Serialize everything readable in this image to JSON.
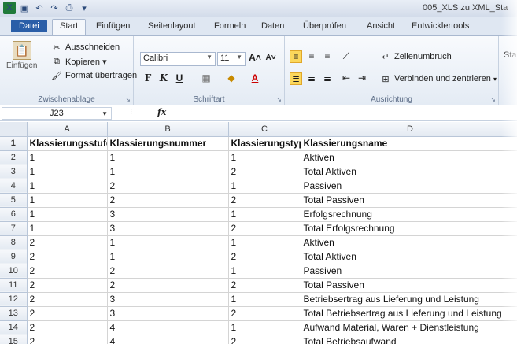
{
  "window": {
    "title": "005_XLS zu XML_Sta"
  },
  "tabs": [
    "Datei",
    "Start",
    "Einfügen",
    "Seitenlayout",
    "Formeln",
    "Daten",
    "Überprüfen",
    "Ansicht",
    "Entwicklertools"
  ],
  "ribbon": {
    "clipboard": {
      "paste": "Einfügen",
      "cut": "Ausschneiden",
      "copy": "Kopieren ▾",
      "format": "Format übertragen",
      "label": "Zwischenablage"
    },
    "font": {
      "name": "Calibri",
      "size": "11",
      "label": "Schriftart",
      "bold": "F",
      "italic": "K",
      "underline": "U"
    },
    "alignment": {
      "wrap": "Zeilenumbruch",
      "merge": "Verbinden und zentrieren",
      "label": "Ausrichtung"
    },
    "styles_cut": "Sta"
  },
  "formula_bar": {
    "cell": "J23",
    "fx": "fx"
  },
  "columns": [
    "A",
    "B",
    "C",
    "D"
  ],
  "rows": [
    {
      "n": "1",
      "cells": [
        "Klassierungsstufe",
        "Klassierungsnummer",
        "Klassierungstyp",
        "Klassierungsname"
      ]
    },
    {
      "n": "2",
      "cells": [
        "1",
        "1",
        "1",
        "Aktiven"
      ]
    },
    {
      "n": "3",
      "cells": [
        "1",
        "1",
        "2",
        "Total Aktiven"
      ]
    },
    {
      "n": "4",
      "cells": [
        "1",
        "2",
        "1",
        "Passiven"
      ]
    },
    {
      "n": "5",
      "cells": [
        "1",
        "2",
        "2",
        "Total Passiven"
      ]
    },
    {
      "n": "6",
      "cells": [
        "1",
        "3",
        "1",
        "Erfolgsrechnung"
      ]
    },
    {
      "n": "7",
      "cells": [
        "1",
        "3",
        "2",
        "Total Erfolgsrechnung"
      ]
    },
    {
      "n": "8",
      "cells": [
        "2",
        "1",
        "1",
        "Aktiven"
      ]
    },
    {
      "n": "9",
      "cells": [
        "2",
        "1",
        "2",
        "Total Aktiven"
      ]
    },
    {
      "n": "10",
      "cells": [
        "2",
        "2",
        "1",
        "Passiven"
      ]
    },
    {
      "n": "11",
      "cells": [
        "2",
        "2",
        "2",
        "Total Passiven"
      ]
    },
    {
      "n": "12",
      "cells": [
        "2",
        "3",
        "1",
        "Betriebsertrag aus Lieferung und Leistung"
      ]
    },
    {
      "n": "13",
      "cells": [
        "2",
        "3",
        "2",
        "Total Betriebsertrag aus Lieferung und Leistung"
      ]
    },
    {
      "n": "14",
      "cells": [
        "2",
        "4",
        "1",
        "Aufwand Material, Waren + Dienstleistung"
      ]
    },
    {
      "n": "15",
      "cells": [
        "2",
        "4",
        "2",
        "Total Betriebsaufwand"
      ]
    }
  ]
}
